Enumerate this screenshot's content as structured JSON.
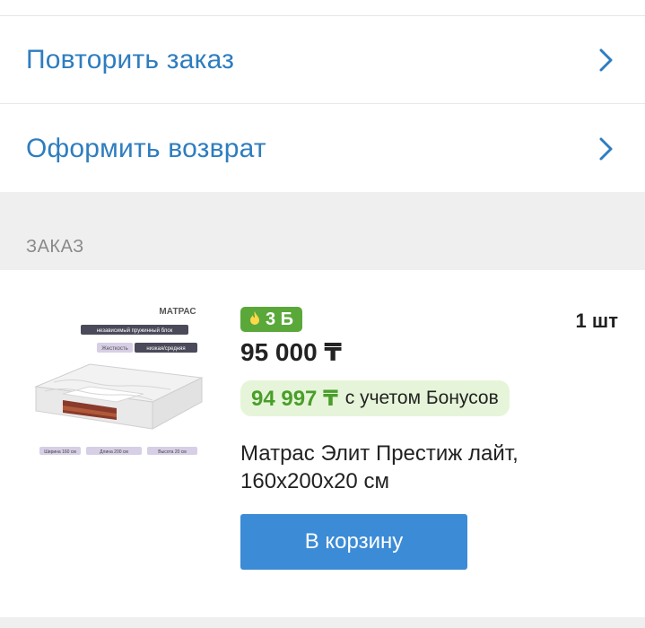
{
  "actions": {
    "repeat_label": "Повторить заказ",
    "return_label": "Оформить возврат"
  },
  "section": {
    "title": "ЗАКАЗ"
  },
  "order": {
    "image": {
      "heading": "МАТРАС",
      "tag1": "независимый пружинный блок",
      "tag2_label": "Жесткость",
      "tag2_value": "низкая/средняя",
      "dim1": "Ширина 160 см",
      "dim2": "Длина 200 см",
      "dim3": "Высота 20 см"
    },
    "bonus_badge": "3 Б",
    "quantity": "1 шт",
    "price": "95 000 ₸",
    "bonus_price": "94 997 ₸",
    "bonus_price_note": "с учетом Бонусов",
    "product_name": "Матрас Элит Престиж лайт, 160x200x20 см",
    "cart_button": "В корзину"
  },
  "colors": {
    "link": "#2e7dbf",
    "button": "#3c8bd6",
    "bonus_green": "#5aa83a",
    "bonus_bg": "#e6f5d9"
  }
}
